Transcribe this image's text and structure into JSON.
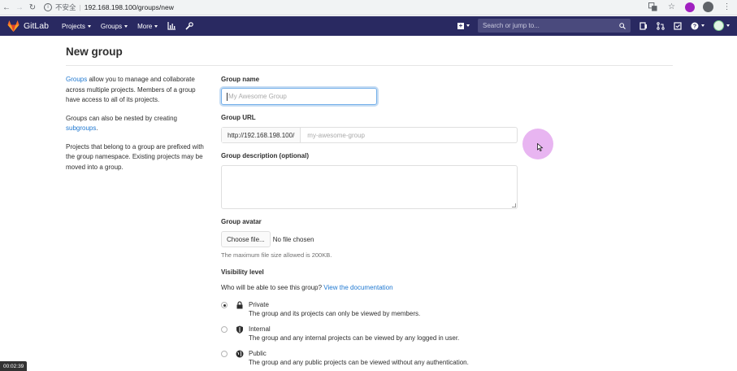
{
  "browser": {
    "security_label": "不安全",
    "url": "192.168.198.100/groups/new"
  },
  "header": {
    "brand": "GitLab",
    "nav": [
      {
        "label": "Projects"
      },
      {
        "label": "Groups"
      },
      {
        "label": "More"
      }
    ],
    "search_placeholder": "Search or jump to..."
  },
  "page": {
    "title": "New group",
    "intro": {
      "p1_link": "Groups",
      "p1_text": " allow you to manage and collaborate across multiple projects. Members of a group have access to all of its projects.",
      "p2_text": "Groups can also be nested by creating ",
      "p2_link": "subgroups",
      "p2_end": ".",
      "p3_text": "Projects that belong to a group are prefixed with the group namespace. Existing projects may be moved into a group."
    }
  },
  "form": {
    "group_name_label": "Group name",
    "group_name_placeholder": "My Awesome Group",
    "group_url_label": "Group URL",
    "group_url_prefix": "http://192.168.198.100/",
    "group_url_placeholder": "my-awesome-group",
    "description_label": "Group description (optional)",
    "avatar_label": "Group avatar",
    "choose_file_label": "Choose file...",
    "no_file_label": "No file chosen",
    "max_size_help": "The maximum file size allowed is 200KB.",
    "visibility_label": "Visibility level",
    "visibility_question": "Who will be able to see this group? ",
    "visibility_doc_link": "View the documentation",
    "visibility_options": [
      {
        "name": "Private",
        "desc": "The group and its projects can only be viewed by members.",
        "checked": true
      },
      {
        "name": "Internal",
        "desc": "The group and any internal projects can be viewed by any logged in user.",
        "checked": false
      },
      {
        "name": "Public",
        "desc": "The group and any public projects can be viewed without any authentication.",
        "checked": false
      }
    ]
  },
  "recording": {
    "timer": "00:02:39"
  }
}
